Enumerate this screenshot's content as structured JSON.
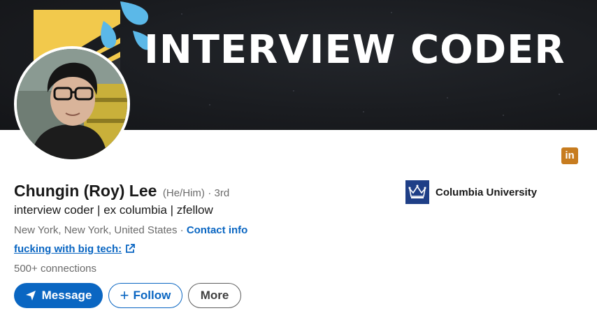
{
  "banner": {
    "title": "INTERVIEW CODER",
    "background_color": "#1a1c20",
    "logo_color": "#f2c94c",
    "drop_color": "#5bb8e8"
  },
  "profile": {
    "name": "Chungin (Roy) Lee",
    "pronouns": "(He/Him)",
    "degree": "· 3rd",
    "headline": "interview coder | ex columbia | zfellow",
    "location": "New York, New York, United States",
    "location_separator": "·",
    "contact_info": "Contact info",
    "link_text": "fucking with big tech:",
    "connections": "500+ connections"
  },
  "actions": {
    "message": "Message",
    "follow": "Follow",
    "more": "More"
  },
  "education": {
    "school": "Columbia University",
    "logo_color": "#1f3f87"
  },
  "icons": {
    "linkedin": "in",
    "message": "send-icon",
    "follow": "plus-icon",
    "external": "external-link-icon",
    "school": "crown-icon"
  },
  "colors": {
    "accent": "#0a66c2",
    "text_primary": "#191919",
    "text_secondary": "#6b6b6b",
    "linkedin_badge": "#c77c1f"
  }
}
